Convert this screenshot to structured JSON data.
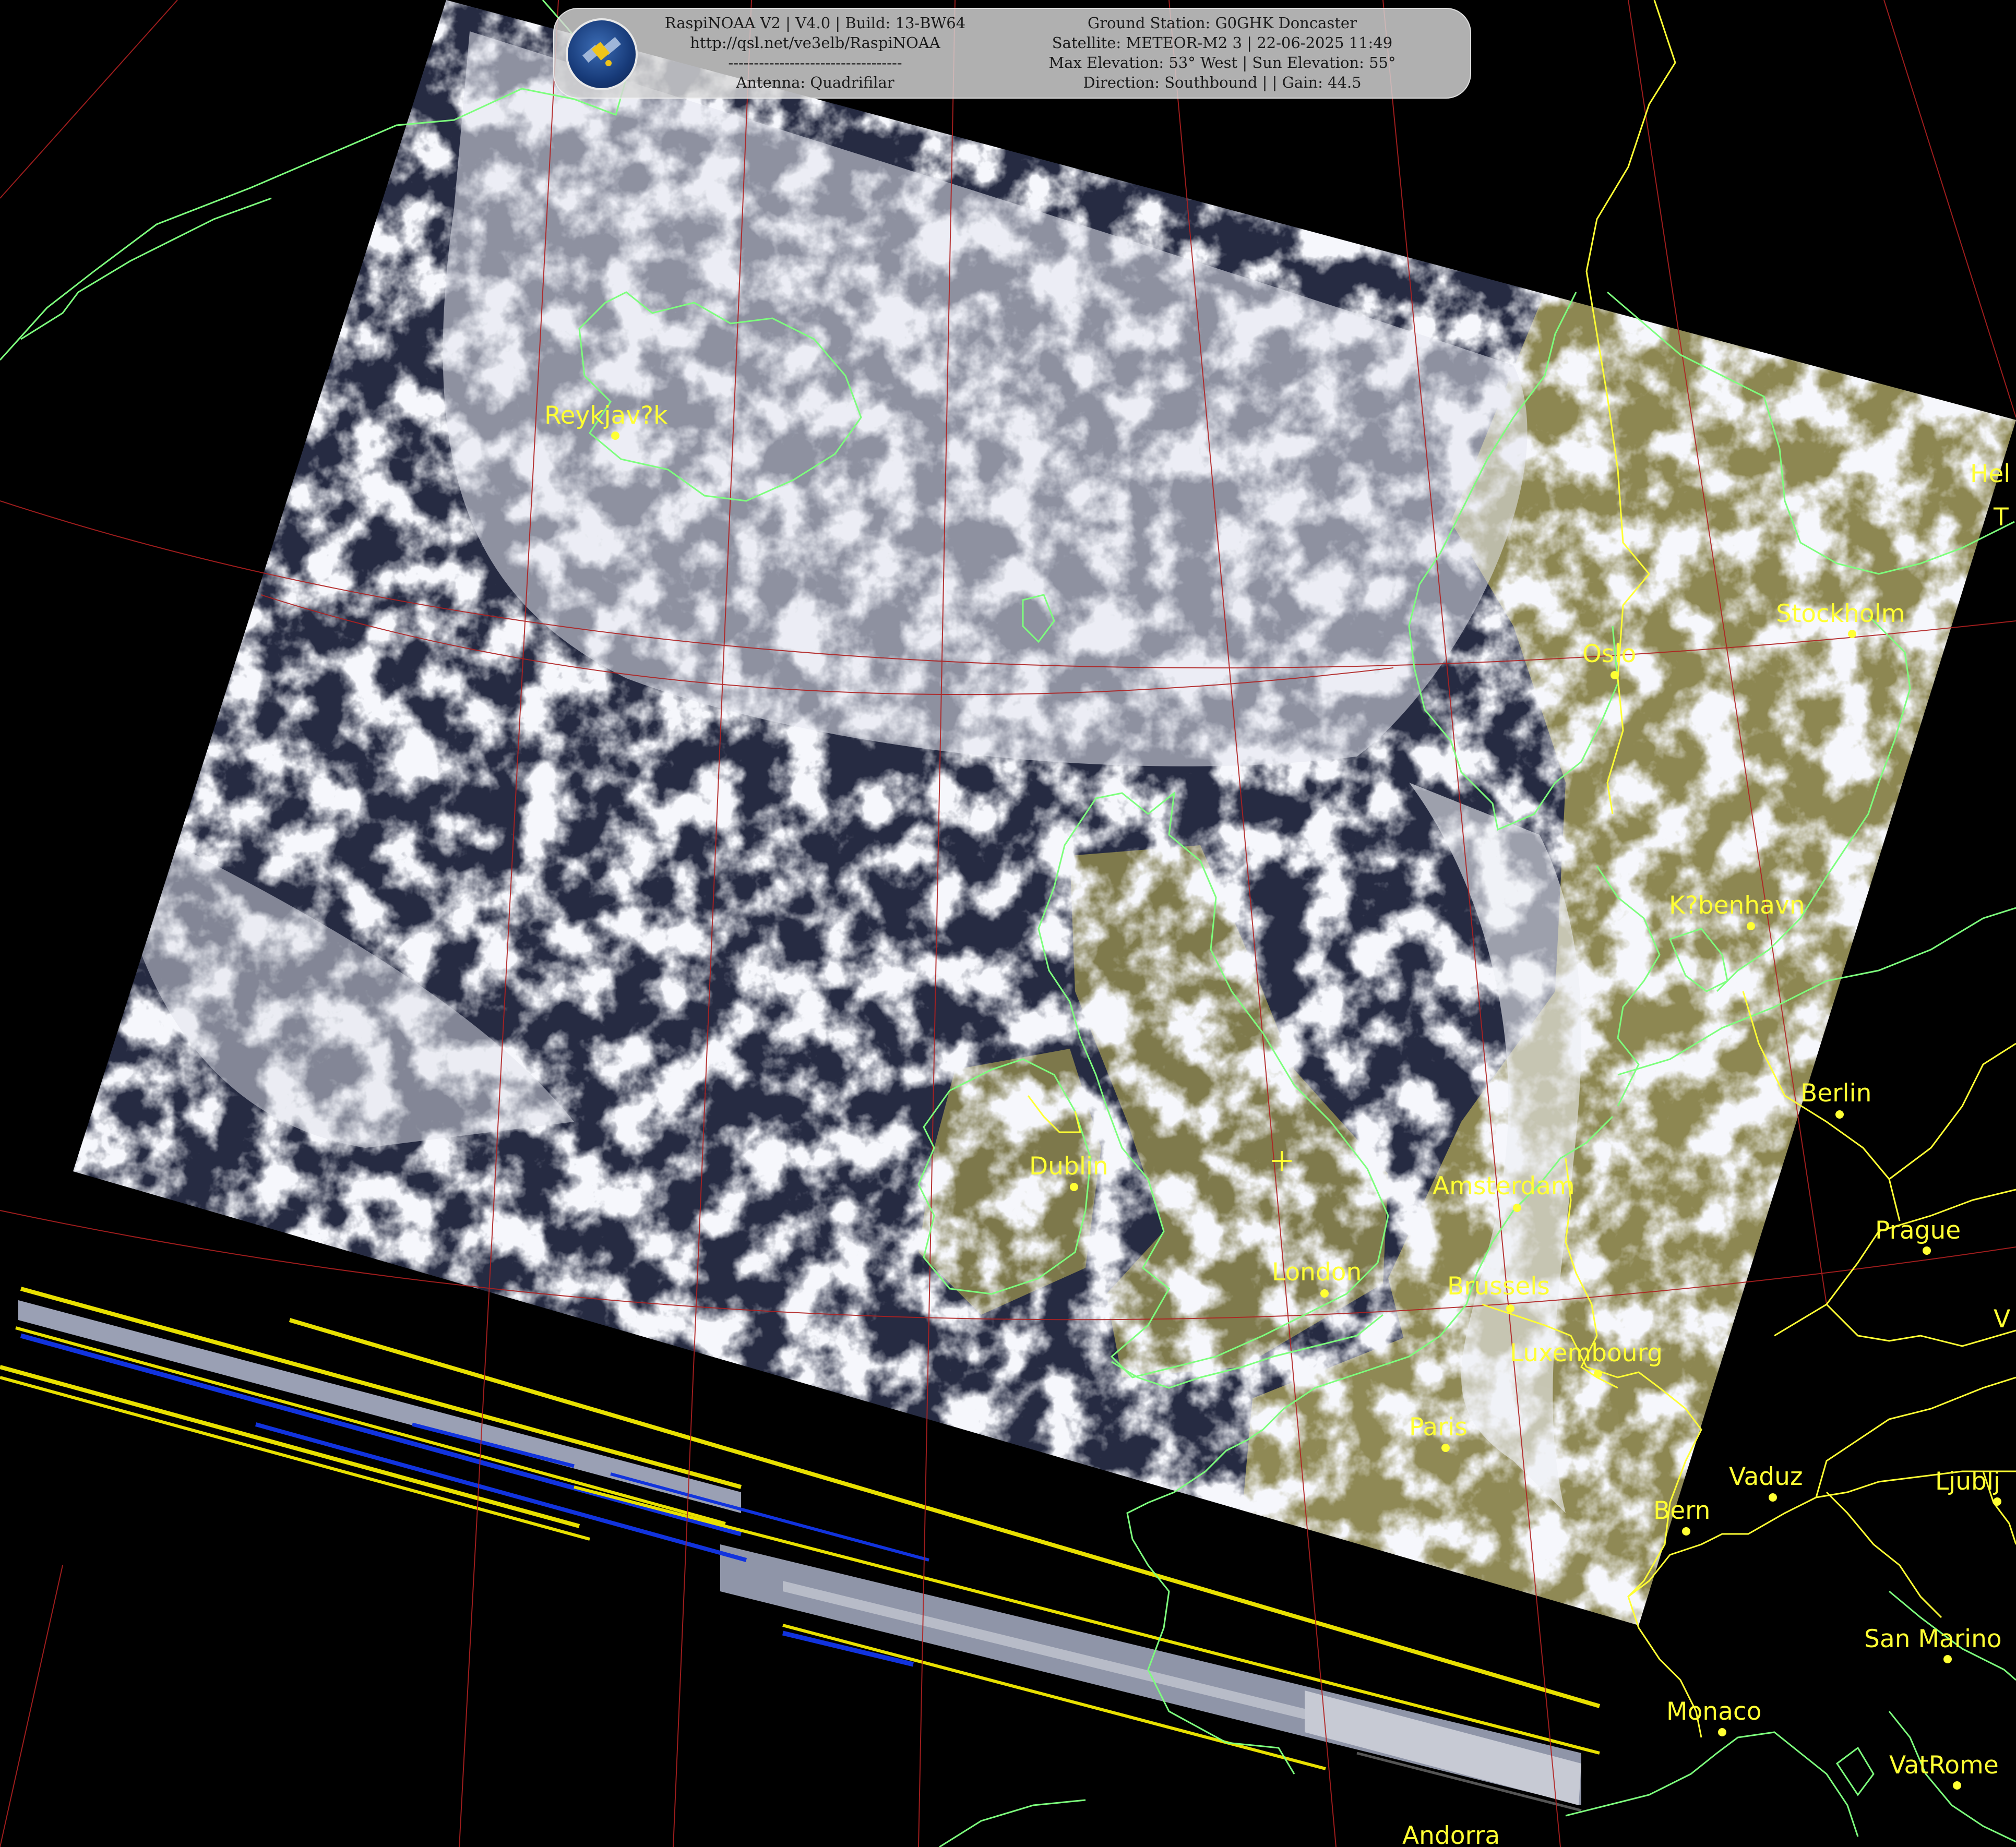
{
  "header": {
    "line1_left": "RaspiNOAA V2 | V4.0 | Build: 13-BW64",
    "line2_left": "http://qsl.net/ve3elb/RaspiNOAA",
    "line3_left": "----------------------------------",
    "line4_left": "Antenna: Quadrifilar",
    "line1_right": "Ground Station: G0GHK Doncaster",
    "line2_right": "Satellite: METEOR-M2 3 | 22-06-2025 11:49",
    "line3_right": "Max Elevation: 53° West | Sun Elevation: 55°",
    "line4_right": "Direction: Southbound | | Gain: 44.5",
    "logo_icon": "satellite-logo-icon"
  },
  "cities": {
    "reykjavik": "Reykjav?k",
    "oslo": "Oslo",
    "stockholm": "Stockholm",
    "kobenhavn": "K?benhavn",
    "helsinki": "Hel",
    "tallinn": "T",
    "berlin": "Berlin",
    "prague": "Prague",
    "vienna": "V",
    "amsterdam": "Amsterdam",
    "brussels": "Brussels",
    "luxembourg": "Luxembourg",
    "paris": "Paris",
    "london": "London",
    "dublin": "Dublin",
    "vaduz": "Vaduz",
    "bern": "Bern",
    "ljubljana": "Ljublj",
    "san_marino": "San Marino",
    "monaco": "Monaco",
    "vatican_rome": "VatRome",
    "andorra": "Andorra"
  },
  "colors": {
    "coastline": "#7dff7d",
    "border": "#ffff33",
    "grid": "#b02020",
    "label": "#ffff33",
    "cloud": "#e6e8f0",
    "ocean": "#252a40",
    "land": "#8a8550"
  }
}
